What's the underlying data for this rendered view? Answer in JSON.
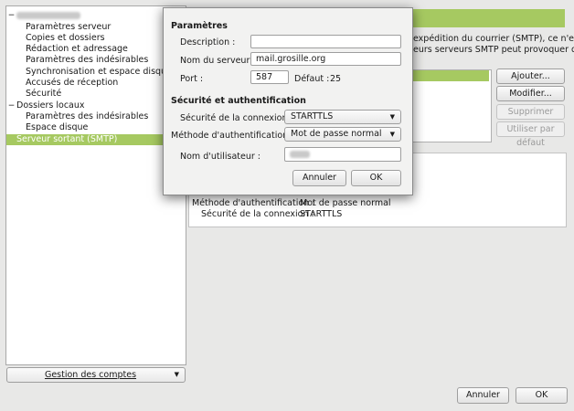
{
  "tree": {
    "items": [
      {
        "label": "",
        "kind": "top",
        "blurred": true,
        "toggle": "−"
      },
      {
        "label": "Paramètres serveur",
        "kind": "child"
      },
      {
        "label": "Copies et dossiers",
        "kind": "child"
      },
      {
        "label": "Rédaction et adressage",
        "kind": "child"
      },
      {
        "label": "Paramètres des indésirables",
        "kind": "child"
      },
      {
        "label": "Synchronisation et espace disque",
        "kind": "child"
      },
      {
        "label": "Accusés de réception",
        "kind": "child"
      },
      {
        "label": "Sécurité",
        "kind": "child"
      },
      {
        "label": "Dossiers locaux",
        "kind": "top",
        "toggle": "−"
      },
      {
        "label": "Paramètres des indésirables",
        "kind": "child"
      },
      {
        "label": "Espace disque",
        "kind": "child"
      },
      {
        "label": "Serveur sortant (SMTP)",
        "kind": "top",
        "selected": true
      }
    ],
    "accounts_button": "Gestion des comptes"
  },
  "right_panel": {
    "intro_line1": "expédition du courrier (SMTP), ce n'est",
    "intro_line2": "eurs serveurs SMTP peut provoquer des",
    "buttons": {
      "add": "Ajouter...",
      "edit": "Modifier...",
      "remove": "Supprimer",
      "default": "Utiliser par défaut"
    },
    "details": [
      {
        "key": "Méthode d'authentification :",
        "value": "Mot de passe normal"
      },
      {
        "key": "Sécurité de la connexion :",
        "value": "STARTTLS"
      }
    ]
  },
  "dialog": {
    "section_params": "Paramètres",
    "description_label": "Description :",
    "description_value": "",
    "server_label": "Nom du serveur :",
    "server_value": "mail.grosille.org",
    "port_label": "Port :",
    "port_value": "587",
    "port_default_label": "Défaut :",
    "port_default_value": "25",
    "section_security": "Sécurité et authentification",
    "connection_security_label": "Sécurité de la connexion :",
    "connection_security_value": "STARTTLS",
    "auth_method_label": "Méthode d'authentification :",
    "auth_method_value": "Mot de passe normal",
    "username_label": "Nom d'utilisateur :",
    "cancel": "Annuler",
    "ok": "OK"
  },
  "footer": {
    "cancel": "Annuler",
    "ok": "OK"
  },
  "colors": {
    "accent": "#a6c961"
  }
}
